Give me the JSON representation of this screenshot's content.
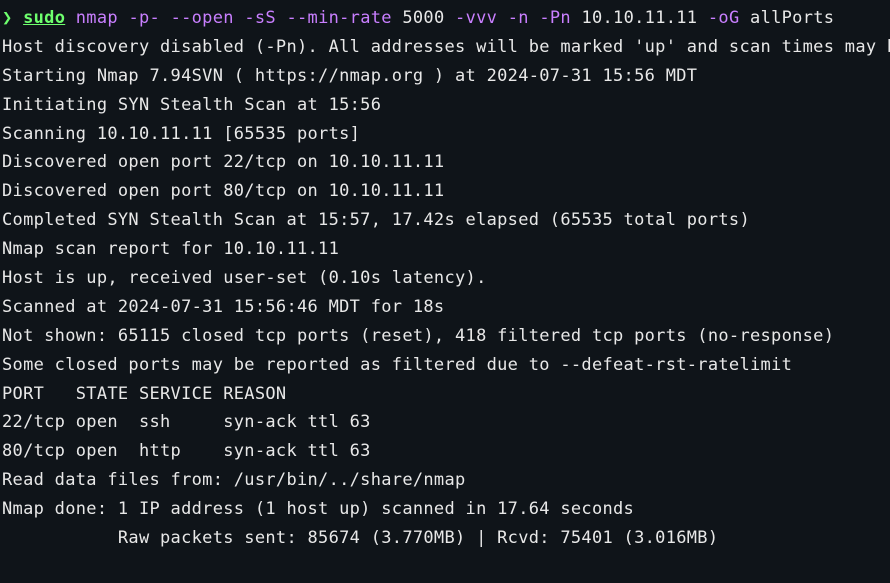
{
  "prompt": {
    "symbol": "❯",
    "sudo": "sudo",
    "segments": [
      {
        "type": "cmd",
        "text": " nmap -p- --open -sS --min-rate "
      },
      {
        "type": "arg",
        "text": "5000"
      },
      {
        "type": "cmd",
        "text": " -vvv -n -Pn "
      },
      {
        "type": "arg",
        "text": "10.10.11.11"
      },
      {
        "type": "cmd",
        "text": " -oG "
      },
      {
        "type": "arg",
        "text": "allPorts"
      }
    ]
  },
  "output": [
    "Host discovery disabled (-Pn). All addresses will be marked 'up' and scan times may be slower.",
    "Starting Nmap 7.94SVN ( https://nmap.org ) at 2024-07-31 15:56 MDT",
    "Initiating SYN Stealth Scan at 15:56",
    "Scanning 10.10.11.11 [65535 ports]",
    "Discovered open port 22/tcp on 10.10.11.11",
    "Discovered open port 80/tcp on 10.10.11.11",
    "Completed SYN Stealth Scan at 15:57, 17.42s elapsed (65535 total ports)",
    "Nmap scan report for 10.10.11.11",
    "Host is up, received user-set (0.10s latency).",
    "Scanned at 2024-07-31 15:56:46 MDT for 18s",
    "Not shown: 65115 closed tcp ports (reset), 418 filtered tcp ports (no-response)",
    "Some closed ports may be reported as filtered due to --defeat-rst-ratelimit",
    "PORT   STATE SERVICE REASON",
    "22/tcp open  ssh     syn-ack ttl 63",
    "80/tcp open  http    syn-ack ttl 63",
    "",
    "Read data files from: /usr/bin/../share/nmap",
    "Nmap done: 1 IP address (1 host up) scanned in 17.64 seconds",
    "           Raw packets sent: 85674 (3.770MB) | Rcvd: 75401 (3.016MB)"
  ]
}
